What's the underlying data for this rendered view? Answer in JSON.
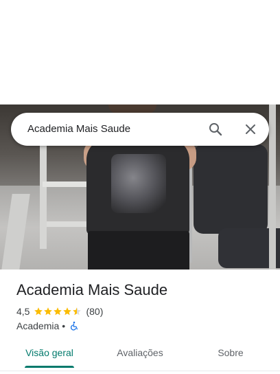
{
  "search": {
    "query": "Academia Mais Saude"
  },
  "place": {
    "title": "Academia Mais Saude",
    "rating": "4,5",
    "stars_value": 4.5,
    "review_count": "(80)",
    "category": "Academia",
    "separator": "•"
  },
  "tabs": [
    {
      "label": "Visão geral",
      "active": true
    },
    {
      "label": "Avaliações",
      "active": false
    },
    {
      "label": "Sobre",
      "active": false
    }
  ],
  "colors": {
    "accent": "#00796b",
    "star": "#fbbc04",
    "accessibility": "#1a73e8"
  },
  "icons": {
    "search": "search-icon",
    "close": "close-icon",
    "wheelchair": "wheelchair-icon",
    "star": "star-icon"
  }
}
